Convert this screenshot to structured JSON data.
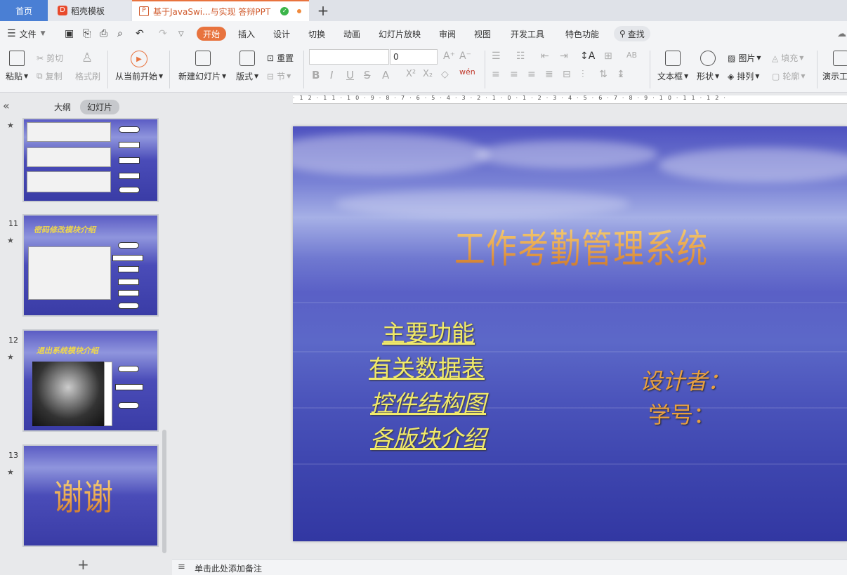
{
  "tabs": {
    "home": "首页",
    "daoke": "稻壳模板",
    "doc": "基于JavaSwi...与实现 答辩PPT"
  },
  "menu": {
    "file": "文件",
    "items": [
      "开始",
      "插入",
      "设计",
      "切换",
      "动画",
      "幻灯片放映",
      "审阅",
      "视图",
      "开发工具",
      "特色功能"
    ],
    "search": "查找"
  },
  "toolbar": {
    "paste": "粘贴",
    "cut": "剪切",
    "copy": "复制",
    "format_painter": "格式刷",
    "play_from": "从当前开始",
    "new_slide": "新建幻灯片",
    "layout": "版式",
    "reset": "重置",
    "section": "节",
    "font_size": "0",
    "textbox": "文本框",
    "shape": "形状",
    "picture": "图片",
    "arrange": "排列",
    "fill": "填充",
    "outline": "轮廓",
    "presenter": "演示工"
  },
  "panel": {
    "outline_tab": "大纲",
    "slides_tab": "幻灯片",
    "slides": [
      {
        "num": "",
        "title": ""
      },
      {
        "num": "11",
        "title": "密码修改模块介绍"
      },
      {
        "num": "12",
        "title": "退出系统模块介绍"
      },
      {
        "num": "13",
        "title": "谢谢"
      }
    ]
  },
  "slide": {
    "title": "工作考勤管理系统",
    "links": [
      "主要功能",
      "有关数据表",
      "控件结构图",
      "各版块介绍"
    ],
    "designer": "设计者：",
    "student_id": "学号："
  },
  "status": {
    "notes": "单击此处添加备注"
  },
  "ruler": {
    "ticks": "·12·11·10·9·8·7·6·5·4·3·2·1·0·1·2·3·4·5·6·7·8·9·10·11·12·"
  },
  "colors": {
    "accent": "#e8733e",
    "home_tab": "#4a7fd4"
  }
}
